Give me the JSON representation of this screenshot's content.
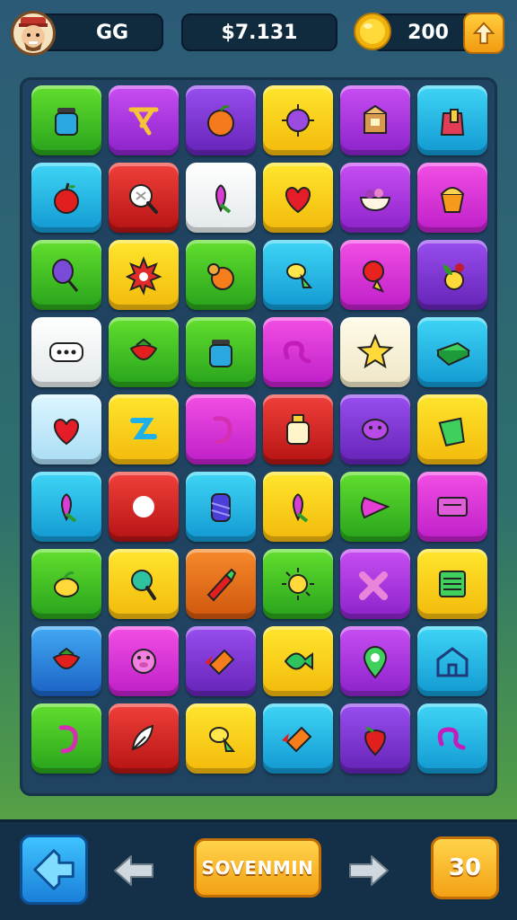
{
  "hud": {
    "level": "GG",
    "money": "$7.131",
    "coins": "200"
  },
  "bottom": {
    "main_button": "SOVENMIN",
    "count_button": "30"
  },
  "tiles": [
    [
      "green:jar",
      "purple:symbol",
      "violet:orange",
      "yellow:virus",
      "purple:box",
      "cyan:bag"
    ],
    [
      "cyan:apple",
      "red:pan",
      "white:flower",
      "yellow:heart",
      "purple:bowl",
      "magenta:cup"
    ],
    [
      "green:balloon",
      "yellow:burst",
      "green:pear",
      "cyan:candy",
      "magenta:lollipop",
      "violet:fruit"
    ],
    [
      "white:chat-bubble",
      "green:strawberry",
      "green:jar",
      "magenta:ribbon",
      "cream:star",
      "cyan:book"
    ],
    [
      "pale:heart",
      "yellow:squiggle",
      "magenta:hook",
      "red:bottle",
      "violet:blob",
      "yellow:leaf"
    ],
    [
      "cyan:flower",
      "red:skull",
      "cyan:can",
      "yellow:flower",
      "green:pick",
      "magenta:tray"
    ],
    [
      "green:lemon",
      "yellow:paddle",
      "orange:crayon",
      "green:sun",
      "purple:cross",
      "yellow:board"
    ],
    [
      "blue:strawberry",
      "magenta:pig",
      "violet:rocket",
      "yellow:fish",
      "purple:map-pin",
      "cyan:house"
    ],
    [
      "green:hook",
      "red:feather",
      "yellow:candy",
      "cyan:rocket",
      "violet:berry",
      "cyan:ribbon"
    ]
  ]
}
